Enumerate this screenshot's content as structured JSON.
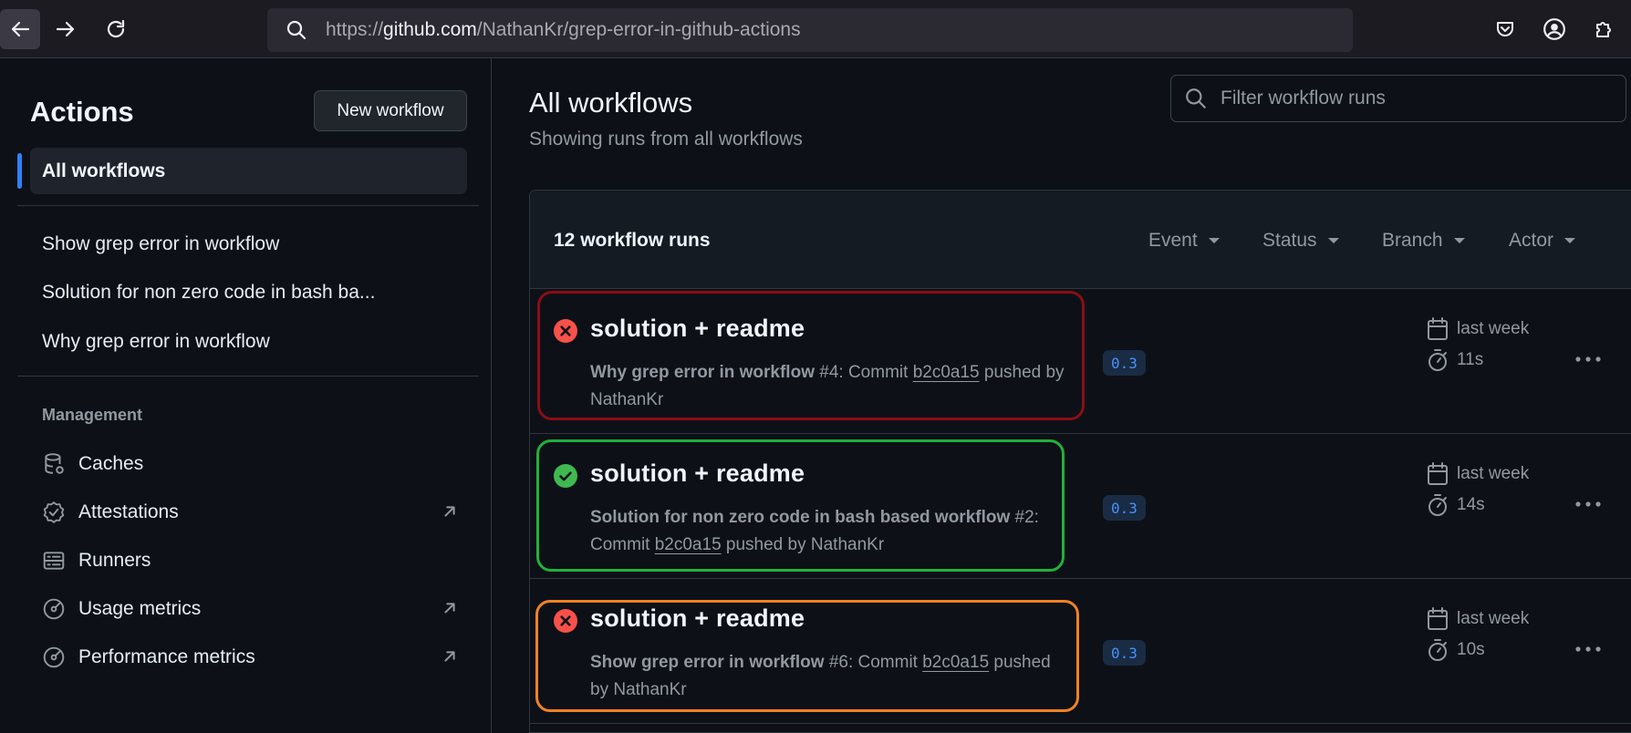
{
  "browser": {
    "url_prefix": "https://",
    "url_host": "github.com",
    "url_path": "/NathanKr/grep-error-in-github-actions"
  },
  "sidebar": {
    "title": "Actions",
    "new_workflow_label": "New workflow",
    "all_workflows_label": "All workflows",
    "workflows": [
      "Show grep error in workflow",
      "Solution for non zero code in bash ba...",
      "Why grep error in workflow"
    ],
    "management_heading": "Management",
    "management": [
      {
        "label": "Caches",
        "icon": "database-icon",
        "external": false
      },
      {
        "label": "Attestations",
        "icon": "verified-icon",
        "external": true
      },
      {
        "label": "Runners",
        "icon": "server-icon",
        "external": false
      },
      {
        "label": "Usage metrics",
        "icon": "meter-icon",
        "external": true
      },
      {
        "label": "Performance metrics",
        "icon": "meter-icon",
        "external": true
      }
    ]
  },
  "main": {
    "title": "All workflows",
    "subtitle": "Showing runs from all workflows",
    "filter_placeholder": "Filter workflow runs",
    "runs_count": "12 workflow runs",
    "filters": [
      "Event",
      "Status",
      "Branch",
      "Actor"
    ],
    "runs": [
      {
        "status": "failure",
        "title": "solution + readme",
        "workflow": "Why grep error in workflow",
        "run_number": "#4",
        "desc_mid": ": Commit ",
        "sha": "b2c0a15",
        "desc_end": " pushed by NathanKr",
        "branch": "0.3",
        "when": "last week",
        "duration": "11s",
        "highlight": "#8b0d16"
      },
      {
        "status": "success",
        "title": "solution + readme",
        "workflow": "Solution for non zero code in bash based workflow",
        "run_number": "#2",
        "desc_mid": ": Commit ",
        "sha": "b2c0a15",
        "desc_end": " pushed by NathanKr",
        "branch": "0.3",
        "when": "last week",
        "duration": "14s",
        "highlight": "#22b03a"
      },
      {
        "status": "failure",
        "title": "solution + readme",
        "workflow": "Show grep error in workflow",
        "run_number": "#6",
        "desc_mid": ": Commit ",
        "sha": "b2c0a15",
        "desc_end": " pushed by NathanKr",
        "branch": "0.3",
        "when": "last week",
        "duration": "10s",
        "highlight": "#f08224"
      }
    ]
  },
  "colors": {
    "failure": "#f85149",
    "success": "#3fb950",
    "accent": "#2f81f7"
  }
}
